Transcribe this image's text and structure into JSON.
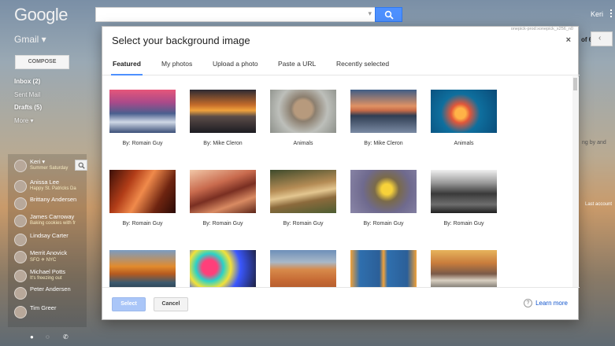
{
  "app": {
    "logo": "Google",
    "label": "Gmail",
    "user": "Keri",
    "page_count": "of 6",
    "frag1": "ng by and",
    "frag2": "Last account"
  },
  "search": {
    "placeholder": ""
  },
  "nav": {
    "compose": "COMPOSE",
    "items": [
      {
        "label": "Inbox (2)",
        "bold": true
      },
      {
        "label": "Sent Mail",
        "bold": false
      },
      {
        "label": "Drafts (5)",
        "bold": true
      },
      {
        "label": "More ▾",
        "bold": false
      }
    ]
  },
  "chat": {
    "contacts": [
      {
        "name": "Keri ▾",
        "status": "Summer Saturday"
      },
      {
        "name": "Anissa Lee",
        "status": "Happy St. Patricks Da"
      },
      {
        "name": "Brittany Andersen",
        "status": ""
      },
      {
        "name": "James Carroway",
        "status": "Baking cookies with fr"
      },
      {
        "name": "Lindsay Carter",
        "status": ""
      },
      {
        "name": "Merrit Anovick",
        "status": "SFO ✈ NYC"
      },
      {
        "name": "Michael Potts",
        "status": "It's freezing out"
      },
      {
        "name": "Peter Andersen",
        "status": ""
      },
      {
        "name": "Tim Greer",
        "status": ""
      }
    ]
  },
  "dialog": {
    "debug": "onepick-prod:xonepick_x256_n0",
    "title": "Select your background image",
    "close": "×",
    "tabs": [
      "Featured",
      "My photos",
      "Upload a photo",
      "Paste a URL",
      "Recently selected"
    ],
    "images": [
      {
        "caption": "By: Romain Guy",
        "scene": "snowy lake sunset"
      },
      {
        "caption": "By: Mike Cleron",
        "scene": "sunset over hills"
      },
      {
        "caption": "Animals",
        "scene": "snow monkey"
      },
      {
        "caption": "By: Mike Cleron",
        "scene": "mountain lake dusk"
      },
      {
        "caption": "Animals",
        "scene": "jellyfish"
      },
      {
        "caption": "By: Romain Guy",
        "scene": "slot canyon"
      },
      {
        "caption": "By: Romain Guy",
        "scene": "sandstone waves"
      },
      {
        "caption": "By: Romain Guy",
        "scene": "wood close-up"
      },
      {
        "caption": "By: Romain Guy",
        "scene": "yellow flower bee"
      },
      {
        "caption": "By: Romain Guy",
        "scene": "black and white city"
      },
      {
        "caption": "",
        "scene": "autumn river"
      },
      {
        "caption": "",
        "scene": "glass flowers"
      },
      {
        "caption": "",
        "scene": "desert dunes"
      },
      {
        "caption": "",
        "scene": "blue shutters"
      },
      {
        "caption": "",
        "scene": "rocky coast sunset"
      }
    ],
    "select": "Select",
    "cancel": "Cancel",
    "learn_more": "Learn more",
    "help_glyph": "?"
  },
  "colors": {
    "accent": "#4d90fe",
    "link": "#1155cc"
  }
}
